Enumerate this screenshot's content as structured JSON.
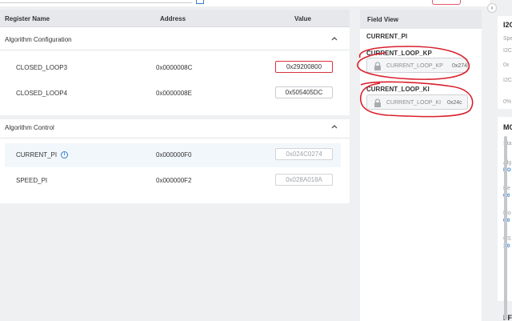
{
  "table": {
    "headers": {
      "name": "Register Name",
      "address": "Address",
      "value": "Value"
    },
    "groups": [
      {
        "title": "Algorithm Configuration",
        "rows": [
          {
            "name": "CLOSED_LOOP3",
            "address": "0x0000008C",
            "value": "0x29200800"
          },
          {
            "name": "CLOSED_LOOP4",
            "address": "0x0000008E",
            "value": "0x505405DC"
          }
        ]
      },
      {
        "title": "Algorithm Control",
        "rows": [
          {
            "name": "CURRENT_PI",
            "address": "0x000000F0",
            "value": "0x024C0274"
          },
          {
            "name": "SPEED_PI",
            "address": "0x000000F2",
            "value": "0x028A018A"
          }
        ]
      }
    ]
  },
  "field_view": {
    "header": "Field View",
    "register": "CURRENT_PI",
    "fields": [
      {
        "label": "CURRENT_LOOP_KP",
        "name": "CURRENT_LOOP_KP",
        "value": "0x274"
      },
      {
        "label": "CURRENT_LOOP_KI",
        "name": "CURRENT_LOOP_KI",
        "value": "0x24c"
      }
    ]
  },
  "right_panel": {
    "expander": "›",
    "items": [
      {
        "text": "I2C",
        "kind": "head"
      },
      {
        "text": "Spe",
        "kind": "text"
      },
      {
        "text": "I2C",
        "kind": "text"
      },
      {
        "text": "0x",
        "kind": "text"
      },
      {
        "text": "I2C",
        "kind": "text"
      },
      {
        "text": "0%",
        "kind": "text"
      },
      {
        "text": "MO",
        "kind": "head"
      },
      {
        "text": "Sta",
        "kind": "text"
      },
      {
        "text": "Alg",
        "kind": "text"
      },
      {
        "text": "MO",
        "kind": "blue"
      },
      {
        "text": "Re",
        "kind": "text"
      },
      {
        "text": "0.0",
        "kind": "blue"
      },
      {
        "text": "Mo",
        "kind": "text"
      },
      {
        "text": "0.0",
        "kind": "blue"
      },
      {
        "text": "CS",
        "kind": "text"
      },
      {
        "text": "1.0",
        "kind": "blue"
      },
      {
        "text": "FF",
        "kind": "head"
      }
    ]
  },
  "colors": {
    "accent": "#2f7fd1",
    "annotation": "#d9202c",
    "header_bg": "#e6e8eb",
    "highlight_row": "#f2f7fb"
  }
}
